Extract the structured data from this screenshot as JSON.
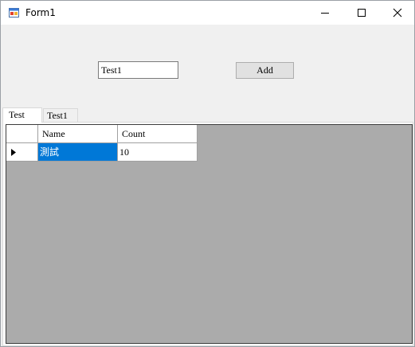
{
  "window": {
    "title": "Form1",
    "minimize_icon": "minimize-icon",
    "maximize_icon": "maximize-icon",
    "close_icon": "close-icon"
  },
  "form": {
    "textbox_value": "Test1",
    "add_button_label": "Add"
  },
  "tabs": [
    {
      "label": "Test",
      "selected": true
    },
    {
      "label": "Test1",
      "selected": false
    }
  ],
  "grid": {
    "columns": [
      "Name",
      "Count"
    ],
    "rows": [
      {
        "name": "測試",
        "count": "10",
        "current": true
      }
    ],
    "current_row_icon": "triangle-right-icon",
    "selection_color": "#0078d7",
    "background_color": "#ababab"
  }
}
